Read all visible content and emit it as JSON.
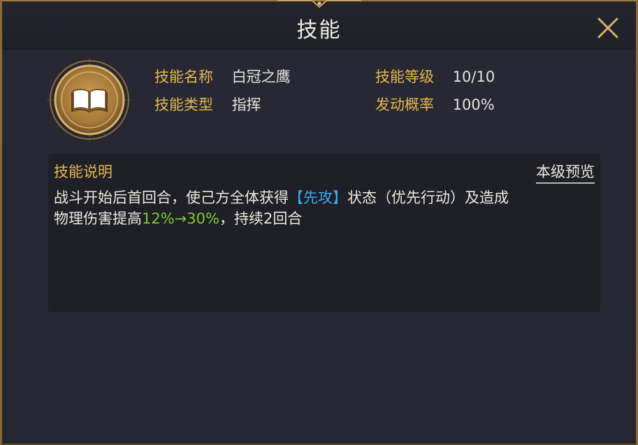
{
  "window": {
    "title": "技能"
  },
  "skill": {
    "fields": [
      {
        "label": "技能名称",
        "value": "白冠之鹰"
      },
      {
        "label": "技能等级",
        "value": "10/10"
      },
      {
        "label": "技能类型",
        "value": "指挥"
      },
      {
        "label": "发动概率",
        "value": "100%"
      }
    ],
    "emblem_icon": "open-book-icon"
  },
  "description": {
    "heading": "技能说明",
    "preview_label": "本级预览",
    "line1_before": "战斗开始后首回合，使己方全体获得",
    "keyword": "【先攻】",
    "line1_after": "状态（优先行动）及造成",
    "line2_before": "物理伤害提高",
    "value_range": "12%→30%",
    "line2_after": "，持续2回合"
  },
  "colors": {
    "accent_gold": "#e4b64e",
    "keyword_blue": "#3aa8ef",
    "value_green": "#7ecb2a"
  }
}
